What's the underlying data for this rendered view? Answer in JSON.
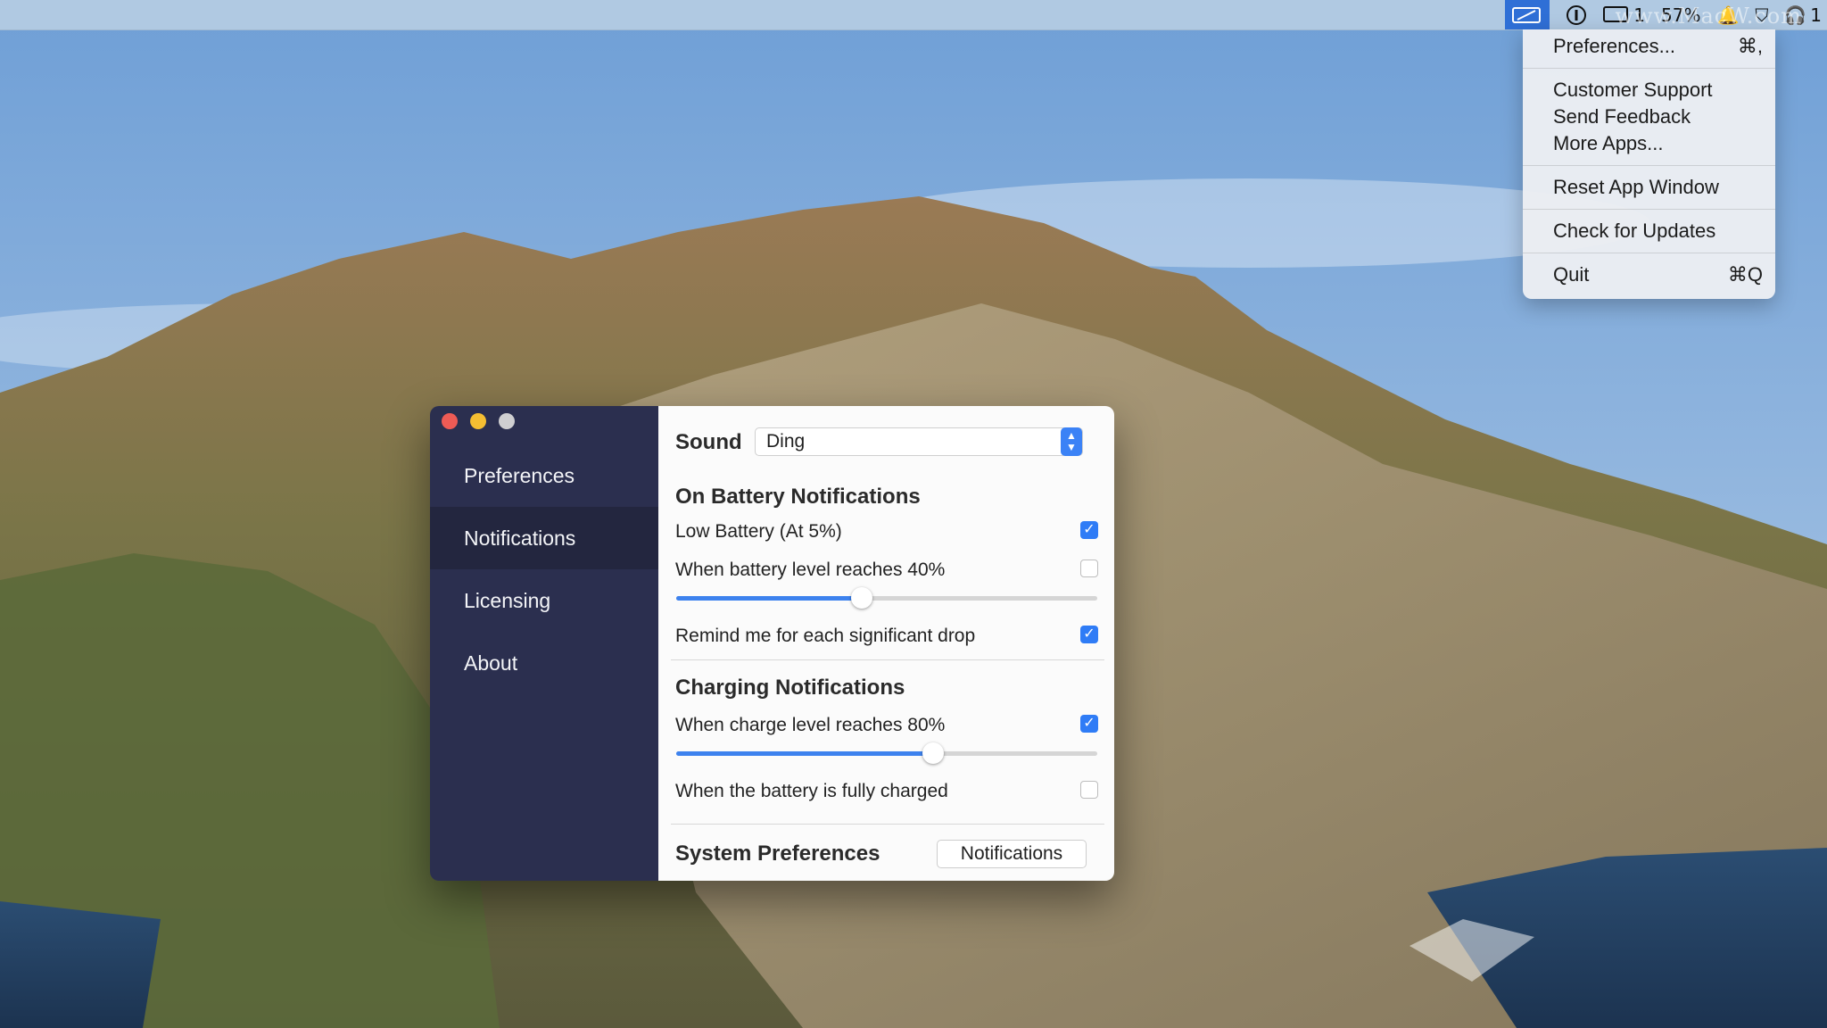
{
  "menubar": {
    "battery_percent": "57%",
    "counter": "1",
    "watermark": "www.MacW.com"
  },
  "dropdown": {
    "items": [
      {
        "label": "Preferences...",
        "shortcut": "⌘,"
      },
      {
        "label": "Customer Support",
        "shortcut": ""
      },
      {
        "label": "Send Feedback",
        "shortcut": ""
      },
      {
        "label": "More Apps...",
        "shortcut": ""
      },
      {
        "label": "Reset App Window",
        "shortcut": ""
      },
      {
        "label": "Check for Updates",
        "shortcut": ""
      },
      {
        "label": "Quit",
        "shortcut": "⌘Q"
      }
    ]
  },
  "sidebar": {
    "items": [
      {
        "label": "Preferences"
      },
      {
        "label": "Notifications"
      },
      {
        "label": "Licensing"
      },
      {
        "label": "About"
      }
    ],
    "active_index": 1
  },
  "content": {
    "sound_label": "Sound",
    "sound_value": "Ding",
    "battery_section_title": "On Battery Notifications",
    "low_battery_label": "Low Battery (At 5%)",
    "low_battery_checked": true,
    "battery_level_label": "When battery level reaches 40%",
    "battery_level_checked": false,
    "battery_level_value": 0.44,
    "remind_label": "Remind me for each significant drop",
    "remind_checked": true,
    "charging_section_title": "Charging Notifications",
    "charge_level_label": "When charge level reaches 80%",
    "charge_level_checked": true,
    "charge_level_value": 0.61,
    "fully_charged_label": "When the battery is fully charged",
    "fully_charged_checked": false,
    "sysprefs_label": "System Preferences",
    "sysprefs_button": "Notifications"
  },
  "colors": {
    "sidebar_bg": "#2b2f4f",
    "sidebar_active": "#23263f",
    "accent": "#2f7cf6"
  }
}
